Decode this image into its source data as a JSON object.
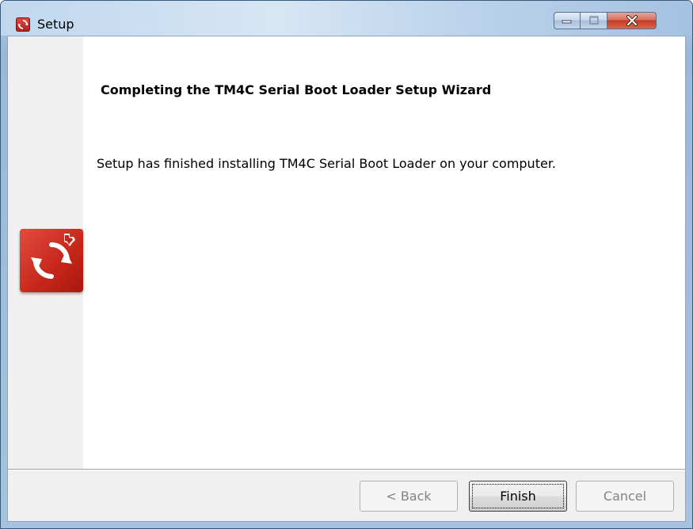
{
  "window": {
    "title": "Setup",
    "app_icon": "setup-app-icon",
    "caption_buttons": [
      "minimize-icon",
      "maximize-icon",
      "close-icon"
    ]
  },
  "wizard": {
    "heading": "Completing the TM4C Serial Boot Loader Setup Wizard",
    "message": "Setup has finished installing TM4C Serial Boot Loader on your computer.",
    "logo_icon": "setup-logo-icon"
  },
  "buttons": {
    "back_label": "< Back",
    "finish_label": "Finish",
    "cancel_label": "Cancel"
  },
  "colors": {
    "titlebar": "#bcd3ea",
    "logo_red": "#c6261a",
    "close_red": "#c53a22"
  }
}
